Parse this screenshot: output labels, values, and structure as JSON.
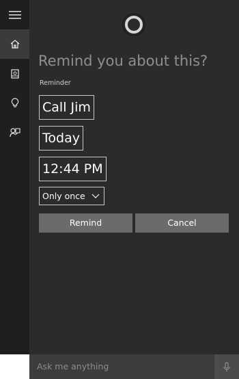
{
  "nav": {
    "items": [
      {
        "icon": "hamburger-menu-icon"
      },
      {
        "icon": "home-icon",
        "active": true
      },
      {
        "icon": "notebook-icon"
      },
      {
        "icon": "lightbulb-icon"
      },
      {
        "icon": "feedback-icon"
      }
    ]
  },
  "reminder": {
    "heading": "Remind you about this?",
    "label": "Reminder",
    "title_value": "Call Jim",
    "date_value": "Today",
    "time_value": "12:44 PM",
    "repeat_value": "Only once",
    "remind_label": "Remind",
    "cancel_label": "Cancel"
  },
  "search": {
    "placeholder": "Ask me anything"
  },
  "colors": {
    "rail_bg": "#1f1f1f",
    "main_bg": "#2b2b2b",
    "button_bg": "#6b6b6b",
    "search_bg": "#3c3c3c"
  }
}
